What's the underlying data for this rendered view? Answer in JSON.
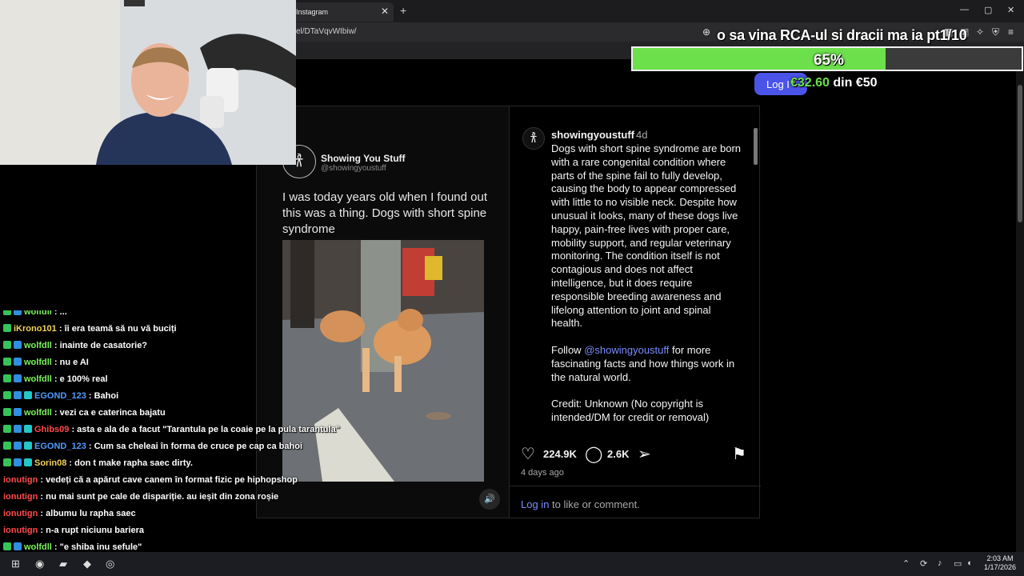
{
  "browser": {
    "tab_title": "Instagram",
    "url": "el/DTaVqvWIbiw/"
  },
  "post": {
    "tweet_name": "Showing You Stuff",
    "tweet_handle": "@showingyoustuff",
    "tweet_text": "I was today years old when I found out this was a thing. Dogs with short spine syndrome",
    "caption_user": "showingyoustuff",
    "caption_time": "4d",
    "caption_body": "Dogs with short spine syndrome are born with a rare congenital condition where parts of the spine fail to fully develop, causing the body to appear compressed with little to no visible neck. Despite how unusual it looks, many of these dogs live happy, pain-free lives with proper care, mobility support, and regular veterinary monitoring. The condition itself is not contagious and does not affect intelligence, but it does require responsible breeding awareness and lifelong attention to joint and spinal health.",
    "follow_prefix": "Follow",
    "follow_mention": "@showingyoustuff",
    "follow_suffix": "for more fascinating facts and how things work in the natural world.",
    "credit": "Credit: Unknown (No copyright is intended/DM for credit or removal)",
    "likes": "224.9K",
    "comments": "2.6K",
    "days_ago": "4 days ago",
    "login_link": "Log in",
    "login_rest": "to like or comment."
  },
  "goal": {
    "title": "o sa vina RCA-ul si dracii ma ia pt1/10",
    "progress_percent": 65,
    "progress_label": "65%",
    "login_pill": "Log I",
    "amount_current": "€32.60",
    "amount_rest": "din €50"
  },
  "chat": [
    {
      "user": "wolfdll",
      "color": "#7cf25a",
      "msg": ": ...",
      "badges": [
        "green",
        "blue"
      ]
    },
    {
      "user": "iKrono101",
      "color": "#f2d15a",
      "msg": ": îi era teamă să nu vă buciți",
      "badges": [
        "green"
      ]
    },
    {
      "user": "wolfdll",
      "color": "#7cf25a",
      "msg": ": inainte de casatorie?",
      "badges": [
        "green",
        "blue"
      ]
    },
    {
      "user": "wolfdll",
      "color": "#7cf25a",
      "msg": ": nu e AI",
      "badges": [
        "green",
        "blue"
      ]
    },
    {
      "user": "wolfdll",
      "color": "#7cf25a",
      "msg": ": e 100% real",
      "badges": [
        "green",
        "blue"
      ]
    },
    {
      "user": "EGOND_123",
      "color": "#4f9cff",
      "msg": ": Bahoi",
      "badges": [
        "green",
        "blue",
        "cyan"
      ]
    },
    {
      "user": "wolfdll",
      "color": "#7cf25a",
      "msg": ": vezi ca e caterinca bajatu",
      "badges": [
        "green",
        "blue"
      ]
    },
    {
      "user": "Ghibs09",
      "color": "#ff4a4a",
      "msg": ": asta e ala de a facut \"Tarantula pe la coaie pe la pula tarantula\"",
      "badges": [
        "green",
        "blue",
        "cyan"
      ]
    },
    {
      "user": "EGOND_123",
      "color": "#4f9cff",
      "msg": ": Cum sa cheleai în forma de cruce pe cap ca bahoi",
      "badges": [
        "green",
        "blue",
        "cyan"
      ]
    },
    {
      "user": "Sorin08",
      "color": "#f2d15a",
      "msg": ": don t make rapha saec dirty.",
      "badges": [
        "green",
        "blue",
        "cyan"
      ]
    },
    {
      "user": "ionutign",
      "color": "#ff4a4a",
      "msg": ": vedeți că a apărut cave canem în format fizic pe hiphopshop",
      "badges": []
    },
    {
      "user": "ionutign",
      "color": "#ff4a4a",
      "msg": ": nu mai sunt pe cale de dispariție. au ieșit din zona roșie",
      "badges": []
    },
    {
      "user": "ionutign",
      "color": "#ff4a4a",
      "msg": ": albumu lu rapha saec",
      "badges": []
    },
    {
      "user": "ionutign",
      "color": "#ff4a4a",
      "msg": ": n-a rupt niciunu bariera",
      "badges": []
    },
    {
      "user": "wolfdll",
      "color": "#7cf25a",
      "msg": ": \"e shiba inu sefule\"",
      "badges": [
        "green",
        "blue"
      ]
    },
    {
      "user": "wolfdll",
      "color": "#7cf25a",
      "msg": ": =)))))",
      "badges": [
        "green",
        "blue"
      ]
    }
  ],
  "taskbar": {
    "time": "2:03 AM",
    "date": "1/17/2026"
  },
  "icons": {
    "like": "heart-icon",
    "comment": "comment-icon",
    "share": "send-icon",
    "save": "bookmark-icon",
    "mute": "speaker-icon"
  }
}
